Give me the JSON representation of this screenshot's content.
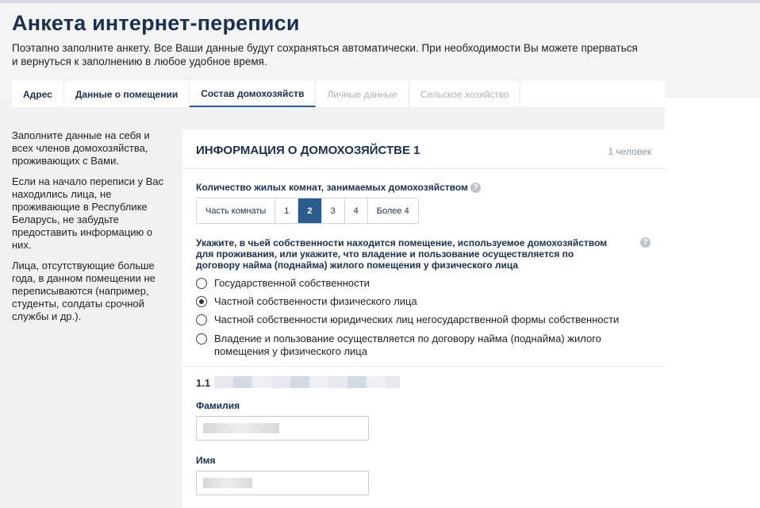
{
  "page": {
    "title": "Анкета интернет-переписи",
    "intro": "Поэтапно заполните анкету. Все Ваши данные будут сохраняться автоматически. При необходимости Вы можете прерваться и вернуться к заполнению в любое удобное время."
  },
  "tabs": [
    {
      "label": "Адрес",
      "state": "enabled"
    },
    {
      "label": "Данные о помещении",
      "state": "enabled"
    },
    {
      "label": "Состав домохозяйств",
      "state": "active"
    },
    {
      "label": "Личные данные",
      "state": "disabled"
    },
    {
      "label": "Сельское хозяйство",
      "state": "disabled"
    }
  ],
  "sidebar": {
    "p1": "Заполните данные на себя и всех членов домохозяйства, проживающих с Вами.",
    "p2": "Если на начало переписи у Вас находились лица, не проживающие в Республике Беларусь, не забудьте предоставить информацию о них.",
    "p3": "Лица, отсутствующие больше года, в данном помещении не переписываются (например, студенты, солдаты срочной службы и др.)."
  },
  "card": {
    "title": "ИНФОРМАЦИЯ О ДОМОХОЗЯЙСТВЕ 1",
    "persons": "1 человек",
    "rooms_question": "Количество жилых комнат, занимаемых домохозяйством",
    "rooms_options": [
      "Часть комнаты",
      "1",
      "2",
      "3",
      "4",
      "Более 4"
    ],
    "rooms_selected": "2",
    "ownership_question": "Укажите, в чьей собственности находится помещение, используемое домохозяйством для проживания, или укажите, что владение и пользование осуществляется по договору найма (поднайма) жилого помещения у физического лица",
    "ownership_options": [
      "Государственной собственности",
      "Частной собственности физического лица",
      "Частной собственности юридических лиц негосударственной формы собственности",
      "Владение и пользование осуществляется по договору найма (поднайма) жилого помещения у физического лица"
    ],
    "ownership_selected": "Частной собственности физического лица",
    "person_number": "1.1",
    "surname_label": "Фамилия",
    "name_label": "Имя",
    "help_icon": "?"
  },
  "colors": {
    "accent": "#2c5b8e",
    "title": "#1c2f4f",
    "disabled_tab": "#aab2bd"
  }
}
